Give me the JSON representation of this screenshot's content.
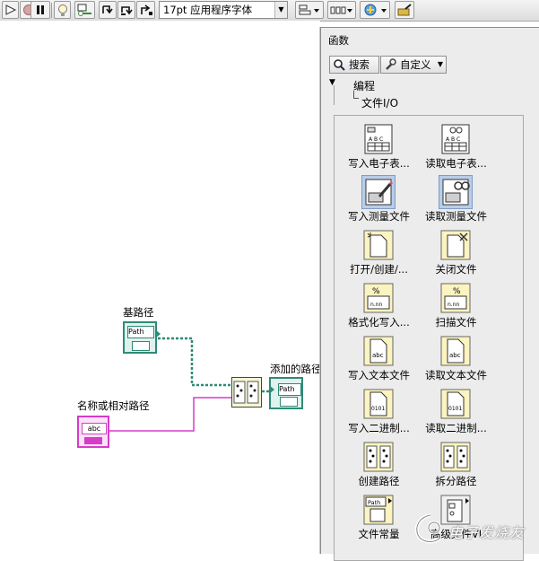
{
  "toolbar": {
    "buttons": [
      {
        "name": "run-arrow-icon"
      },
      {
        "name": "abort-icon"
      },
      {
        "name": "pause-icon"
      },
      {
        "name": "highlight-execution-icon"
      },
      {
        "name": "retain-wire-values-icon"
      },
      {
        "name": "step-into-icon"
      },
      {
        "name": "step-over-icon"
      },
      {
        "name": "step-out-icon"
      },
      {
        "name": "align-objects-icon"
      },
      {
        "name": "distribute-objects-icon"
      },
      {
        "name": "reorder-icon"
      },
      {
        "name": "cleanup-diagram-icon"
      }
    ],
    "font_select": "17pt 应用程序字体"
  },
  "diagram": {
    "base_path_label": "基路径",
    "relative_path_label": "名称或相对路径",
    "appended_path_label": "添加的路径",
    "path_terminal_text": "Path",
    "string_terminal_text": "abc",
    "wire_path_color": "#2e8b77",
    "wire_string_color": "#d63cc8"
  },
  "palette": {
    "title": "函数",
    "search_label": "搜索",
    "customize_label": "自定义",
    "tree": {
      "category": "编程",
      "subcategory": "文件I/O"
    },
    "items": [
      {
        "label": "写入电子表...",
        "icon": "write-spreadsheet-icon",
        "selected": false
      },
      {
        "label": "读取电子表...",
        "icon": "read-spreadsheet-icon",
        "selected": false
      },
      {
        "label": "写入测量文件",
        "icon": "write-measurement-file-icon",
        "selected": true
      },
      {
        "label": "读取测量文件",
        "icon": "read-measurement-file-icon",
        "selected": true
      },
      {
        "label": "打开/创建/...",
        "icon": "open-create-file-icon",
        "selected": false
      },
      {
        "label": "关闭文件",
        "icon": "close-file-icon",
        "selected": false
      },
      {
        "label": "格式化写入...",
        "icon": "format-into-file-icon",
        "selected": false
      },
      {
        "label": "扫描文件",
        "icon": "scan-from-file-icon",
        "selected": false
      },
      {
        "label": "写入文本文件",
        "icon": "write-text-file-icon",
        "selected": false
      },
      {
        "label": "读取文本文件",
        "icon": "read-text-file-icon",
        "selected": false
      },
      {
        "label": "写入二进制...",
        "icon": "write-binary-file-icon",
        "selected": false
      },
      {
        "label": "读取二进制...",
        "icon": "read-binary-file-icon",
        "selected": false
      },
      {
        "label": "创建路径",
        "icon": "build-path-icon",
        "selected": false
      },
      {
        "label": "拆分路径",
        "icon": "strip-path-icon",
        "selected": false
      },
      {
        "label": "文件常量",
        "icon": "file-constants-icon",
        "selected": false
      },
      {
        "label": "高级文件VI",
        "icon": "advanced-file-vis-icon",
        "selected": false
      }
    ]
  },
  "watermark": {
    "text": "电子发烧友"
  }
}
